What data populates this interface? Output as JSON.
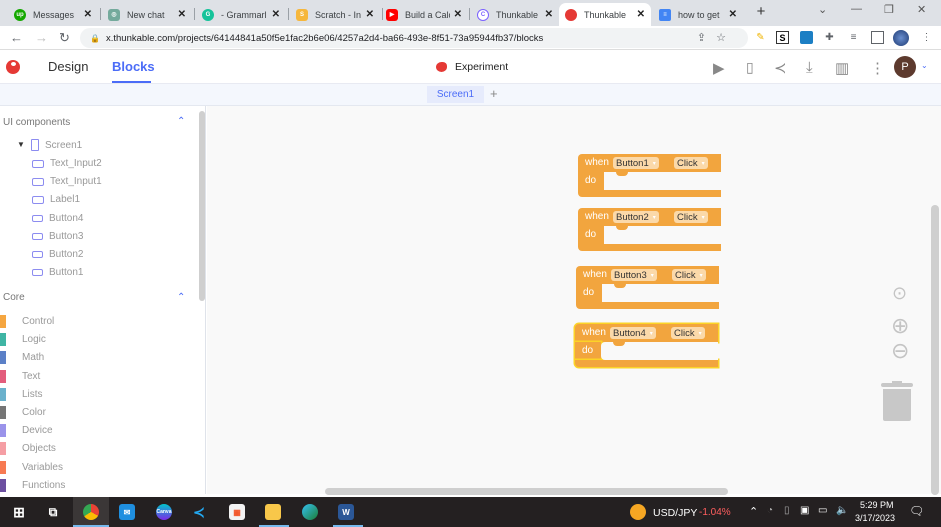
{
  "browser": {
    "tabs": [
      {
        "title": "Messages",
        "icon": "upwork-icon",
        "color": "#14a800",
        "glyph": "up"
      },
      {
        "title": "New chat",
        "icon": "chatgpt-icon",
        "color": "#74aa9c",
        "glyph": "◎"
      },
      {
        "title": "- Grammarl",
        "icon": "grammarly-icon",
        "color": "#15c39a",
        "glyph": "G"
      },
      {
        "title": "Scratch - In",
        "icon": "scratch-icon",
        "color": "#f6b73c",
        "glyph": "S"
      },
      {
        "title": "Build a Calc",
        "icon": "youtube-icon",
        "color": "#ff0000",
        "glyph": "▶"
      },
      {
        "title": "Thunkable",
        "icon": "thunkable-c-icon",
        "color": "#7b61ff",
        "glyph": "C"
      },
      {
        "title": "Thunkable",
        "icon": "thunkable-icon",
        "color": "#e53935",
        "glyph": "●",
        "active": true
      },
      {
        "title": "how to get",
        "icon": "google-docs-icon",
        "color": "#4285f4",
        "glyph": "≡"
      }
    ],
    "close_glyph": "✕",
    "new_tab_glyph": "+",
    "url": "x.thunkable.com/projects/64144841a50f5e1fac2b6e06/4257a2d4-ba66-493e-8f51-73a95944fb37/blocks"
  },
  "app": {
    "nav": {
      "design": "Design",
      "blocks": "Blocks"
    },
    "project_name": "Experiment",
    "avatar_letter": "P",
    "screen_tab": "Screen1",
    "add_screen": "+"
  },
  "sidebar": {
    "ui_section": "UI components",
    "tree": [
      {
        "label": "Screen1",
        "type": "screen"
      },
      {
        "label": "Text_Input2",
        "type": "input"
      },
      {
        "label": "Text_Input1",
        "type": "input"
      },
      {
        "label": "Label1",
        "type": "label"
      },
      {
        "label": "Button4",
        "type": "button"
      },
      {
        "label": "Button3",
        "type": "button"
      },
      {
        "label": "Button2",
        "type": "button"
      },
      {
        "label": "Button1",
        "type": "button"
      }
    ],
    "core_section": "Core",
    "core": [
      {
        "label": "Control",
        "color": "#f5a640"
      },
      {
        "label": "Logic",
        "color": "#3fb5a4"
      },
      {
        "label": "Math",
        "color": "#5b80c7"
      },
      {
        "label": "Text",
        "color": "#e35d7c"
      },
      {
        "label": "Lists",
        "color": "#6ab1cc"
      },
      {
        "label": "Color",
        "color": "#757575"
      },
      {
        "label": "Device",
        "color": "#9a93ea"
      },
      {
        "label": "Objects",
        "color": "#f59ea4"
      },
      {
        "label": "Variables",
        "color": "#f77a52"
      },
      {
        "label": "Functions",
        "color": "#6c4fa0"
      }
    ]
  },
  "workspace": {
    "blocks": [
      {
        "when": "when",
        "component": "Button1",
        "event": "Click",
        "do": "do"
      },
      {
        "when": "when",
        "component": "Button2",
        "event": "Click",
        "do": "do"
      },
      {
        "when": "when",
        "component": "Button3",
        "event": "Click",
        "do": "do"
      },
      {
        "when": "when",
        "component": "Button4",
        "event": "Click",
        "do": "do",
        "selected": true
      }
    ],
    "dropdown_glyph": "▾"
  },
  "taskbar": {
    "ticker_label": "USD/JPY",
    "ticker_value": "-1.04%",
    "ticker_color": "#ff5e5e",
    "time": "5:29 PM",
    "date": "3/17/2023"
  }
}
